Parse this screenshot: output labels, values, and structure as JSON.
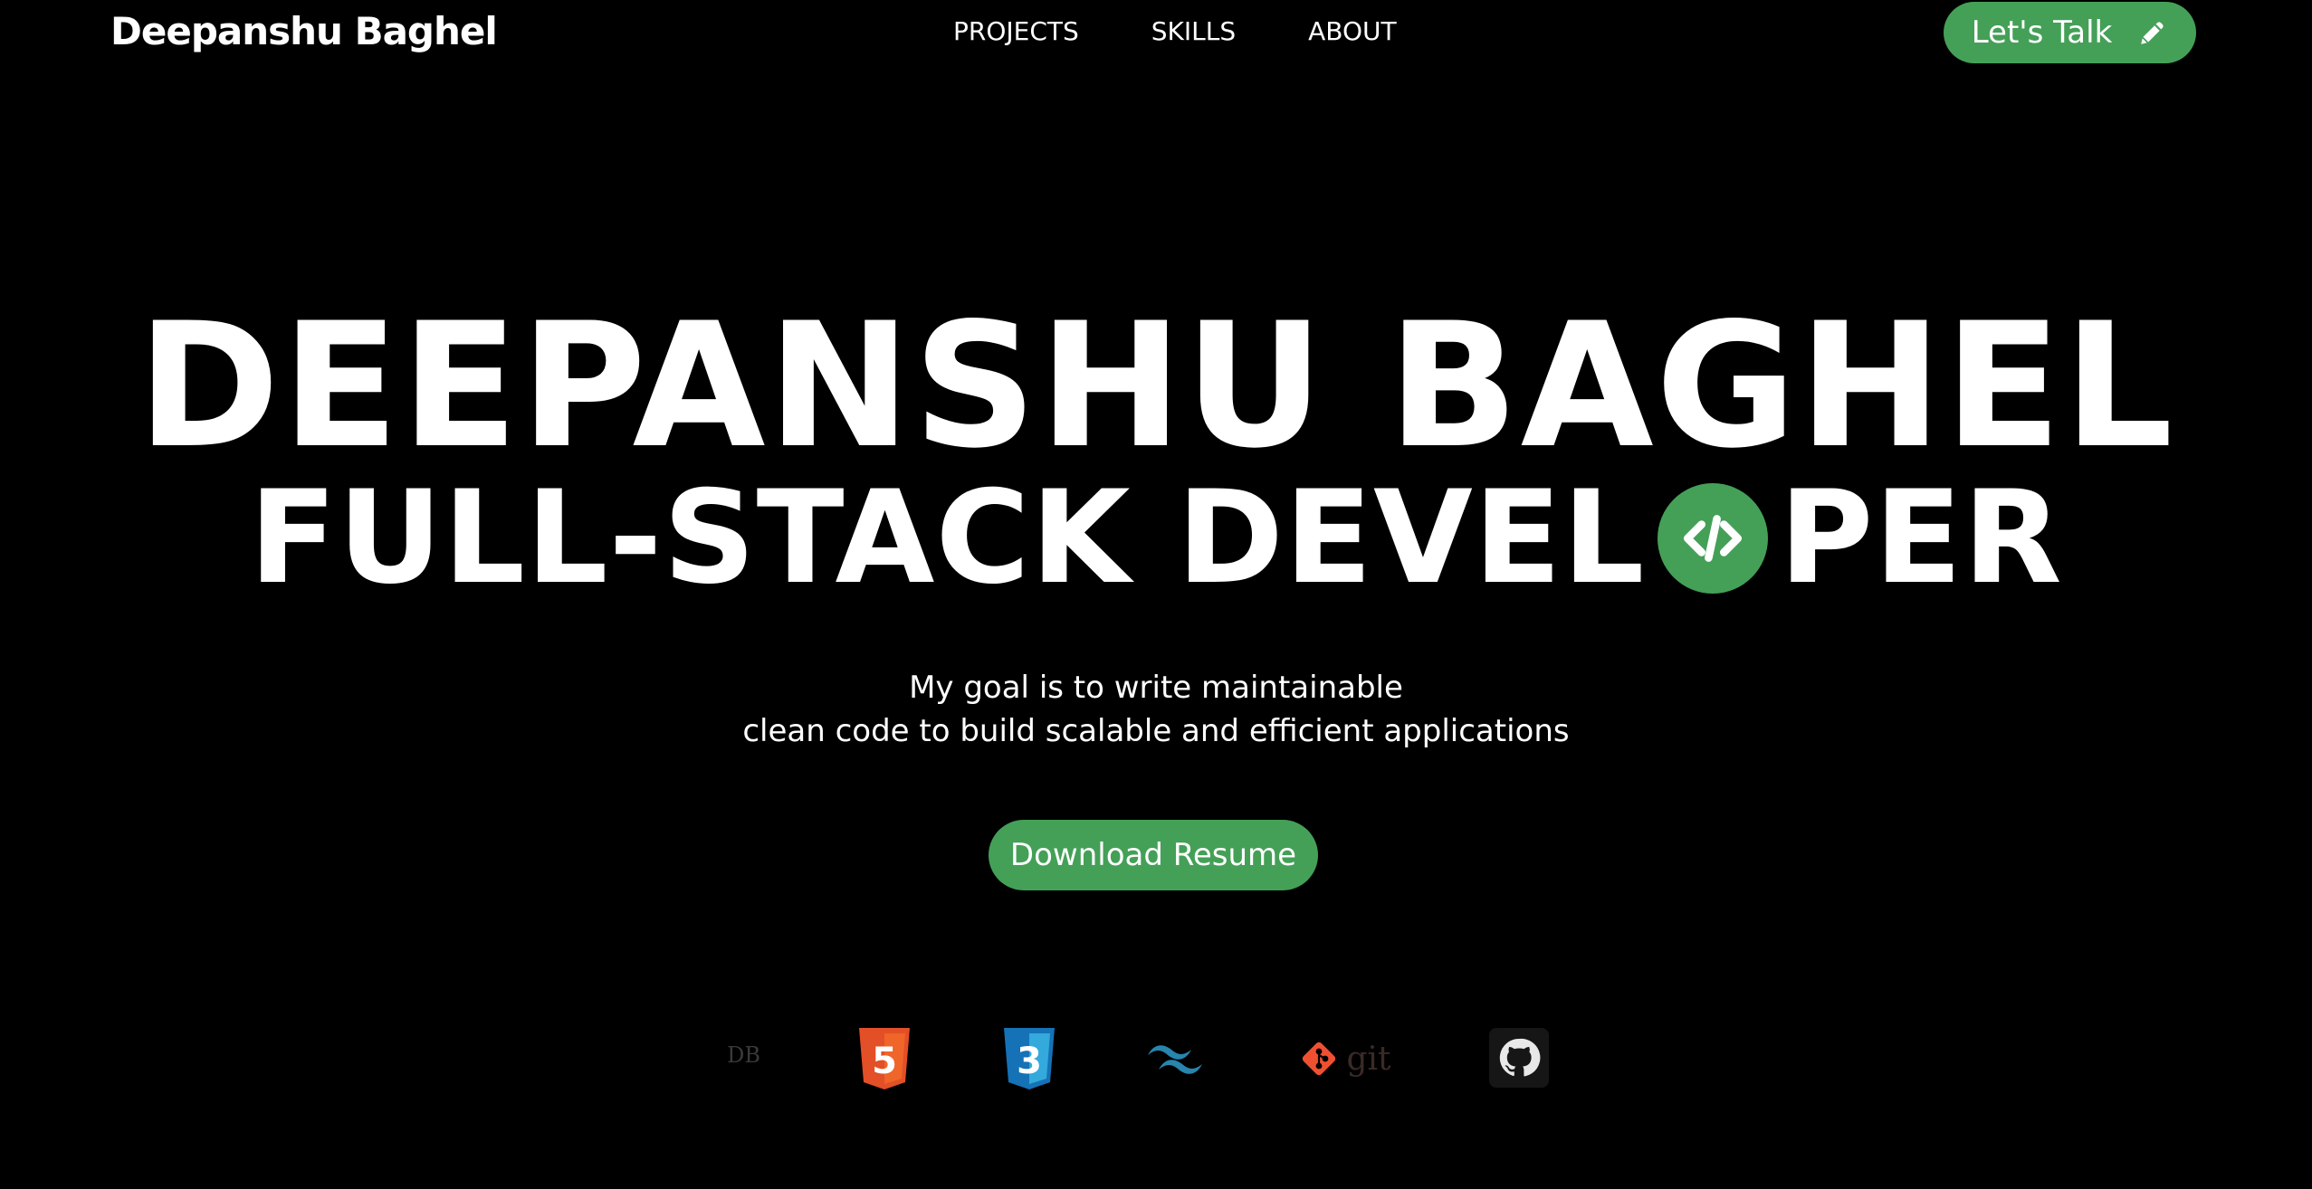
{
  "header": {
    "brand": "Deepanshu Baghel",
    "nav": [
      {
        "label": "PROJECTS"
      },
      {
        "label": "SKILLS"
      },
      {
        "label": "ABOUT"
      }
    ],
    "cta_label": "Let's Talk",
    "cta_icon": "pencil-icon"
  },
  "hero": {
    "name": "DEEPANSHU BAGHEL",
    "role_start": "FULL-STACK DEVEL",
    "role_icon": "code-icon",
    "role_end": "PER",
    "tagline_line1": "My goal is to write maintainable",
    "tagline_line2": "clean code to build scalable and efficient applications",
    "resume_label": "Download Resume"
  },
  "tech_logos": {
    "items": [
      {
        "icon": "mongodb-icon",
        "text": "DB"
      },
      {
        "icon": "html5-icon",
        "text": "5"
      },
      {
        "icon": "css3-icon",
        "text": "3"
      },
      {
        "icon": "tailwind-icon"
      },
      {
        "icon": "git-icon",
        "text": "git"
      },
      {
        "icon": "github-icon"
      }
    ]
  },
  "colors": {
    "background": "#000000",
    "accent": "#44a057",
    "text": "#ffffff",
    "html5": "#e34f26",
    "css3": "#2965f1",
    "tailwind": "#38bdf8",
    "git": "#f05032"
  }
}
